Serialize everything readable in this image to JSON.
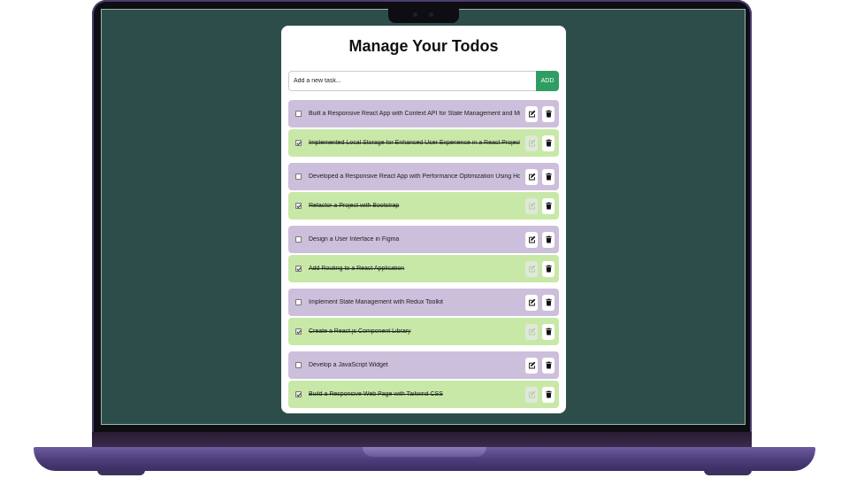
{
  "app": {
    "title": "Manage Your Todos",
    "input_placeholder": "Add a new task...",
    "add_label": "ADD"
  },
  "todos": [
    {
      "text": "Built a Responsive React App with Context API for State Management and Middlews",
      "completed": false
    },
    {
      "text": "Implemented Local Storage for Enhanced User Experience in a React Project",
      "completed": true
    },
    {
      "text": "Developed a Responsive React App with Performance Optimization Using Hooks",
      "completed": false
    },
    {
      "text": "Refactor a Project with Bootstrap",
      "completed": true
    },
    {
      "text": "Design a User Interface in Figma",
      "completed": false
    },
    {
      "text": "Add Routing to a React Application",
      "completed": true
    },
    {
      "text": "Implement State Management with Redux Toolkit",
      "completed": false
    },
    {
      "text": "Create a React.js Component Library",
      "completed": true
    },
    {
      "text": "Develop a JavaScript Widget",
      "completed": false
    },
    {
      "text": "Build a Responsive Web Page with Tailwind CSS",
      "completed": true
    }
  ],
  "icons": {
    "edit": "edit-icon",
    "delete": "trash-icon",
    "check": "checkmark-icon"
  },
  "colors": {
    "screen_background": "#2d4d4b",
    "pending_row": "#ccbfdb",
    "completed_row": "#c8e8a8",
    "add_button": "#2f9e62",
    "laptop_body": "#4b3d7a"
  }
}
